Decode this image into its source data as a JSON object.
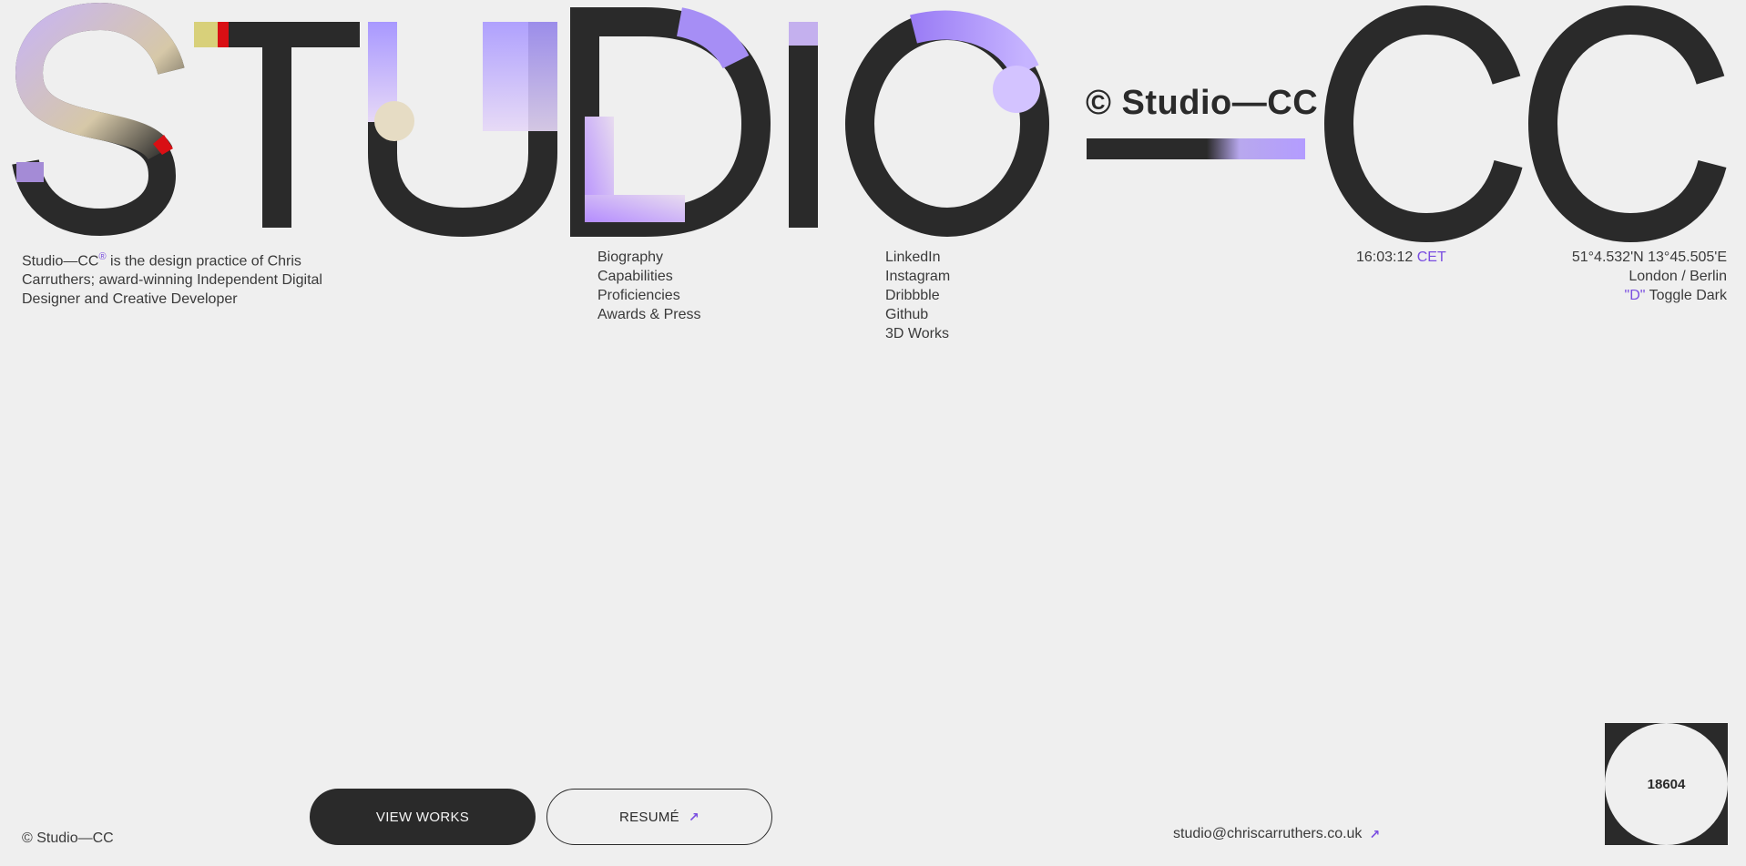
{
  "wordmark": {
    "text": "STUDIO",
    "cc": "CC",
    "middle_label": "© Studio—CC"
  },
  "colors": {
    "ink": "#2a2a2a",
    "background": "#efefef",
    "accent": "#7a4ee0",
    "lavender": "#b39cff"
  },
  "intro": {
    "brand": "Studio—CC",
    "mark": "®",
    "text": " is the design practice of Chris Carruthers; award-winning Independent Digital Designer and Creative Developer"
  },
  "nav": {
    "items": [
      "Biography",
      "Capabilities",
      "Proficiencies",
      "Awards & Press"
    ]
  },
  "social": {
    "items": [
      "LinkedIn",
      "Instagram",
      "Dribbble",
      "Github",
      "3D Works"
    ]
  },
  "clock": {
    "time": "16:03:12",
    "zone": "CET"
  },
  "location": {
    "coords": "51°4.532'N 13°45.505'E",
    "cities": "London / Berlin",
    "toggle_key": "\"D\"",
    "toggle_label": " Toggle Dark"
  },
  "footer": {
    "copyright": "© Studio—CC",
    "view_works": "VIEW WORKS",
    "resume": "RESUMÉ",
    "arrow": "↗",
    "email": "studio@chriscarruthers.co.uk",
    "counter": "18604"
  }
}
